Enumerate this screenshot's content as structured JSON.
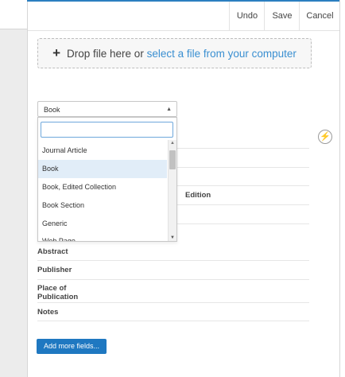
{
  "toolbar": {
    "undo_label": "Undo",
    "save_label": "Save",
    "cancel_label": "Cancel"
  },
  "dropzone": {
    "plus": "+",
    "prefix": "Drop file here or",
    "link": "select a file from your computer"
  },
  "type_select": {
    "value": "Book",
    "arrow": "▲"
  },
  "dropdown": {
    "search_value": "",
    "options": [
      "Journal Article",
      "Book",
      "Book, Edited Collection",
      "Book Section",
      "Generic",
      "Web Page"
    ],
    "selected_index": 1,
    "scroll_up": "▲",
    "scroll_down": "▼"
  },
  "lightning_icon": "⚡",
  "fields": {
    "edition": "Edition",
    "abstract": "Abstract",
    "publisher": "Publisher",
    "place_line1": "Place of",
    "place_line2": "Publication",
    "notes": "Notes"
  },
  "add_more_label": "Add more fields...",
  "colors": {
    "accent": "#2b7fc0",
    "link": "#3a8fd1",
    "button": "#1f78c1",
    "selected_option": "#e1edf8"
  }
}
